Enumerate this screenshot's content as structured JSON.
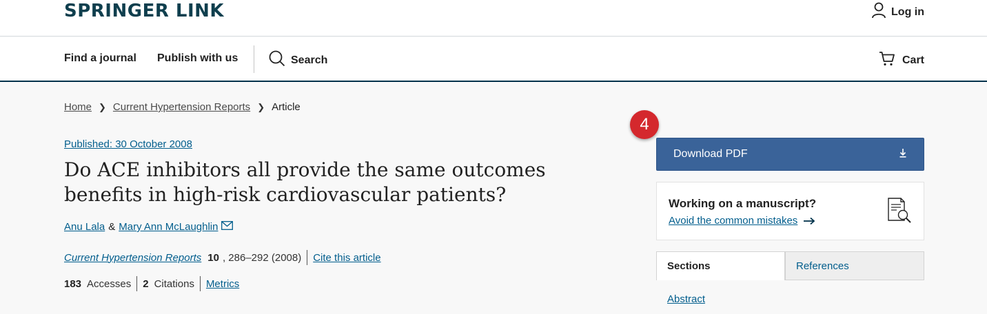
{
  "header": {
    "logo": "SPRINGER LINK",
    "login_label": "Log in"
  },
  "nav": {
    "find_journal": "Find a journal",
    "publish": "Publish with us",
    "search": "Search",
    "cart": "Cart"
  },
  "breadcrumb": {
    "home": "Home",
    "journal": "Current Hypertension Reports",
    "current": "Article"
  },
  "article": {
    "published": "Published: 30 October 2008",
    "title": "Do ACE inhibitors all provide the same outcomes benefits in high-risk cardiovascular patients?",
    "authors": [
      "Anu Lala",
      "Mary Ann McLaughlin"
    ],
    "author_separator": "&",
    "journal": "Current Hypertension Reports",
    "volume": "10",
    "pages": ", 286–292 (2008)",
    "cite_label": "Cite this article",
    "accesses_count": "183",
    "accesses_label": "Accesses",
    "citations_count": "2",
    "citations_label": "Citations",
    "metrics_label": "Metrics"
  },
  "sidebar": {
    "badge": "4",
    "download_pdf": "Download PDF",
    "manuscript_heading": "Working on a manuscript?",
    "manuscript_link": "Avoid the common mistakes",
    "tabs": [
      "Sections",
      "References"
    ],
    "first_section": "Abstract"
  },
  "colors": {
    "brand": "#0f3f4e",
    "link": "#025e8d",
    "button": "#3a6399",
    "badge": "#d4282d"
  }
}
